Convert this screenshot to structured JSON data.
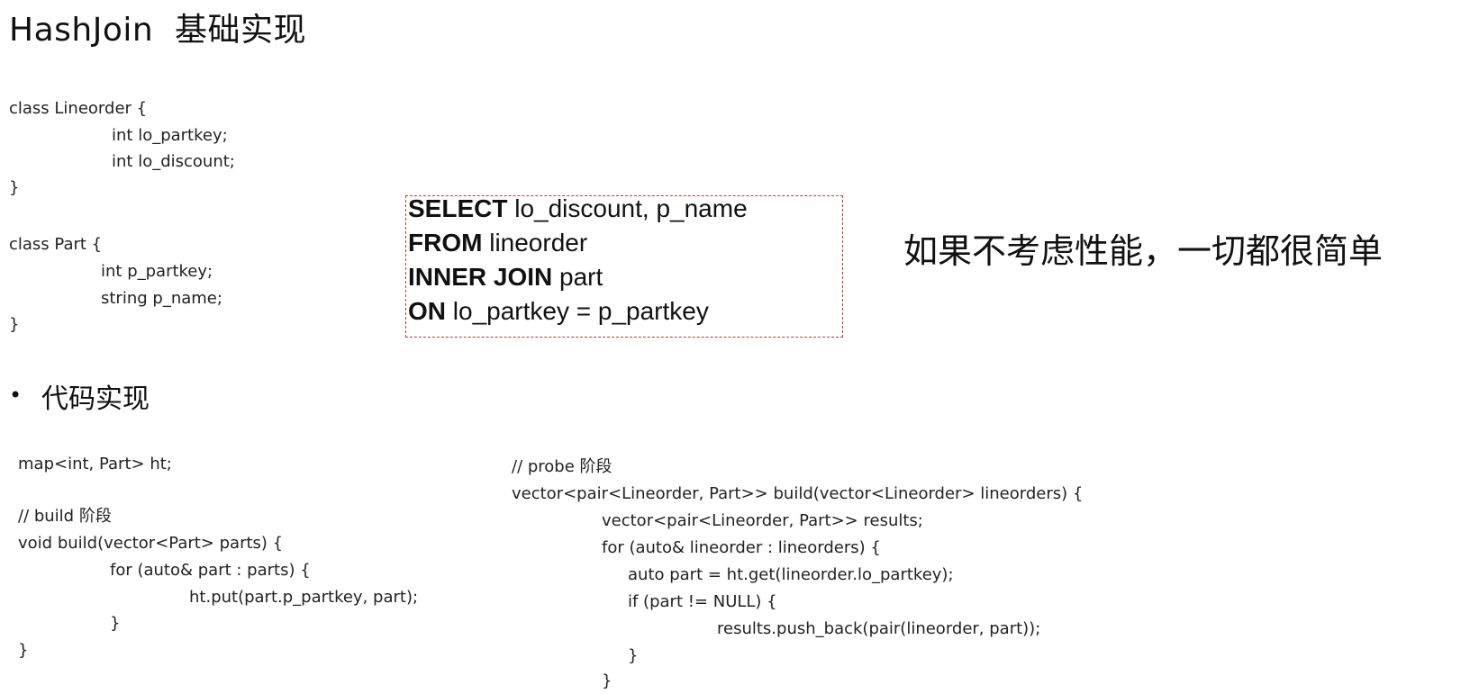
{
  "title": "HashJoin  基础实现",
  "class_defs": [
    "class Lineorder {",
    "int lo_partkey;",
    "int lo_discount;",
    "}",
    "class Part {",
    "int p_partkey;",
    "string p_name;",
    "}"
  ],
  "sql": {
    "select_kw": "SELECT",
    "select_rest": " lo_discount, p_name",
    "from_kw": "FROM",
    "from_rest": " lineorder",
    "join_kw": "INNER JOIN",
    "join_rest": " part",
    "on_kw": "ON",
    "on_rest": " lo_partkey = p_partkey"
  },
  "note": "如果不考虑性能，一切都很简单",
  "bullet": {
    "marker": "•",
    "text": "代码实现"
  },
  "build_code": [
    "map<int, Part> ht;",
    "// build 阶段",
    "void build(vector<Part> parts) {",
    "for (auto& part : parts) {",
    "ht.put(part.p_partkey, part);",
    "}",
    "}"
  ],
  "probe_code": [
    "// probe 阶段",
    "vector<pair<Lineorder, Part>> build(vector<Lineorder> lineorders) {",
    "vector<pair<Lineorder, Part>> results;",
    "for (auto& lineorder : lineorders) {",
    "auto part = ht.get(lineorder.lo_partkey);",
    "if (part != NULL) {",
    "results.push_back(pair(lineorder, part));",
    "}",
    "}"
  ]
}
